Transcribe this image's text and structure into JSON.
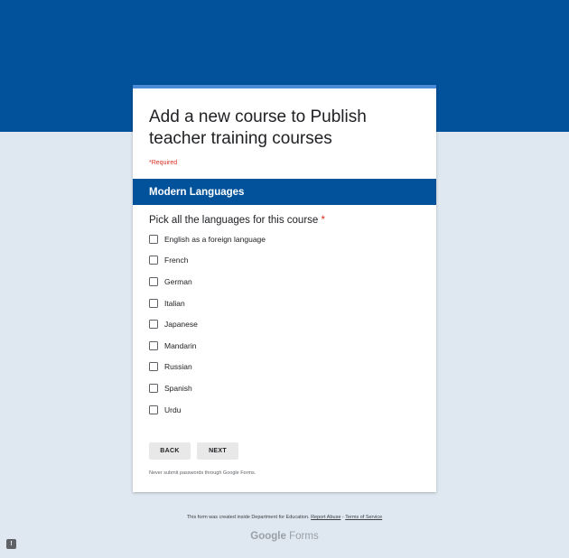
{
  "form": {
    "title": "Add a new course to Publish teacher training courses",
    "required_note": "*Required"
  },
  "section": {
    "title": "Modern Languages"
  },
  "question": {
    "title": "Pick all the languages for this course",
    "required_star": "*",
    "options": [
      {
        "label": "English as a foreign language",
        "checked": false
      },
      {
        "label": "French",
        "checked": false
      },
      {
        "label": "German",
        "checked": false
      },
      {
        "label": "Italian",
        "checked": false
      },
      {
        "label": "Japanese",
        "checked": false
      },
      {
        "label": "Mandarin",
        "checked": false
      },
      {
        "label": "Russian",
        "checked": false
      },
      {
        "label": "Spanish",
        "checked": false
      },
      {
        "label": "Urdu",
        "checked": false
      }
    ]
  },
  "buttons": {
    "back": "BACK",
    "next": "NEXT"
  },
  "password_note": "Never submit passwords through Google Forms.",
  "footer": {
    "created_text": "This form was created inside Department for Education. ",
    "report_abuse": "Report Abuse",
    "separator": " - ",
    "terms": "Terms of Service"
  },
  "brand": {
    "google": "Google",
    "forms": "Forms"
  },
  "feedback_icon": "!",
  "colors": {
    "banner": "#01529b",
    "background": "#dfe8f1",
    "card_top_bar": "#4a8ad6",
    "required": "#d93025"
  }
}
